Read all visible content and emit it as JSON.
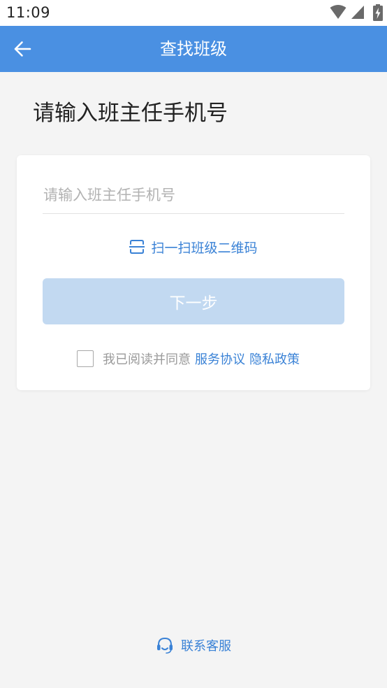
{
  "status_bar": {
    "time": "11:09",
    "icons": [
      "wifi-icon",
      "cell-signal-icon",
      "battery-charging-icon"
    ]
  },
  "app_bar": {
    "title": "查找班级",
    "back_icon": "arrow-left-icon"
  },
  "heading": "请输入班主任手机号",
  "form": {
    "phone_value": "",
    "phone_placeholder": "请输入班主任手机号",
    "scan_label": "扫一扫班级二维码",
    "scan_icon": "scan-icon",
    "next_label": "下一步",
    "agree_checked": false,
    "agree_text": "我已阅读并同意",
    "terms_label": "服务协议",
    "privacy_label": "隐私政策"
  },
  "footer": {
    "contact_label": "联系客服",
    "contact_icon": "headset-icon"
  },
  "colors": {
    "primary": "#4a90e2",
    "link": "#3a82d6",
    "button_disabled": "#c2d9f1",
    "background": "#f4f4f4"
  }
}
